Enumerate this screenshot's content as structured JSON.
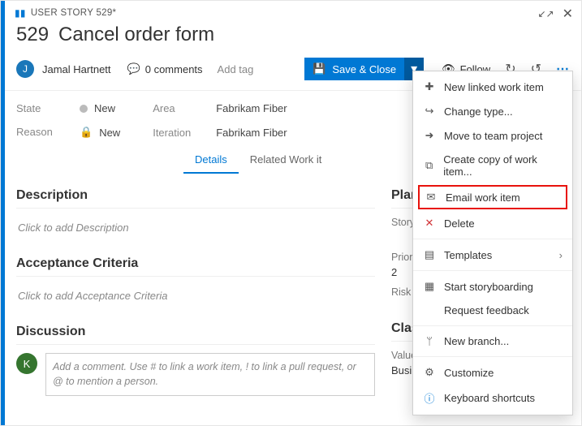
{
  "header": {
    "type_label": "USER STORY 529*",
    "id": "529",
    "title": "Cancel order form"
  },
  "assigned": {
    "initials": "J",
    "name": "Jamal Hartnett"
  },
  "comments_label": "0 comments",
  "add_tag_label": "Add tag",
  "save_label": "Save & Close",
  "follow_label": "Follow",
  "fields": {
    "state_label": "State",
    "state_value": "New",
    "reason_label": "Reason",
    "reason_value": "New",
    "area_label": "Area",
    "area_value": "Fabrikam Fiber",
    "iteration_label": "Iteration",
    "iteration_value": "Fabrikam Fiber"
  },
  "tabs": {
    "details": "Details",
    "related": "Related Work it"
  },
  "sections": {
    "description": "Description",
    "description_placeholder": "Click to add Description",
    "ac": "Acceptance Criteria",
    "ac_placeholder": "Click to add Acceptance Criteria",
    "discussion": "Discussion"
  },
  "side": {
    "planning": "Planning",
    "story_points": "Story Points",
    "priority": "Priority",
    "priority_value": "2",
    "risk": "Risk",
    "classification": "Classificati",
    "value_area": "Value area",
    "value_area_value": "Business"
  },
  "discussion": {
    "avatar": "K",
    "placeholder": "Add a comment. Use # to link a work item, ! to link a pull request, or @ to mention a person."
  },
  "menu": {
    "new_linked": "New linked work item",
    "change_type": "Change type...",
    "move": "Move to team project",
    "copy": "Create copy of work item...",
    "email": "Email work item",
    "delete": "Delete",
    "templates": "Templates",
    "storyboard": "Start storyboarding",
    "feedback": "Request feedback",
    "branch": "New branch...",
    "customize": "Customize",
    "shortcuts": "Keyboard shortcuts"
  }
}
